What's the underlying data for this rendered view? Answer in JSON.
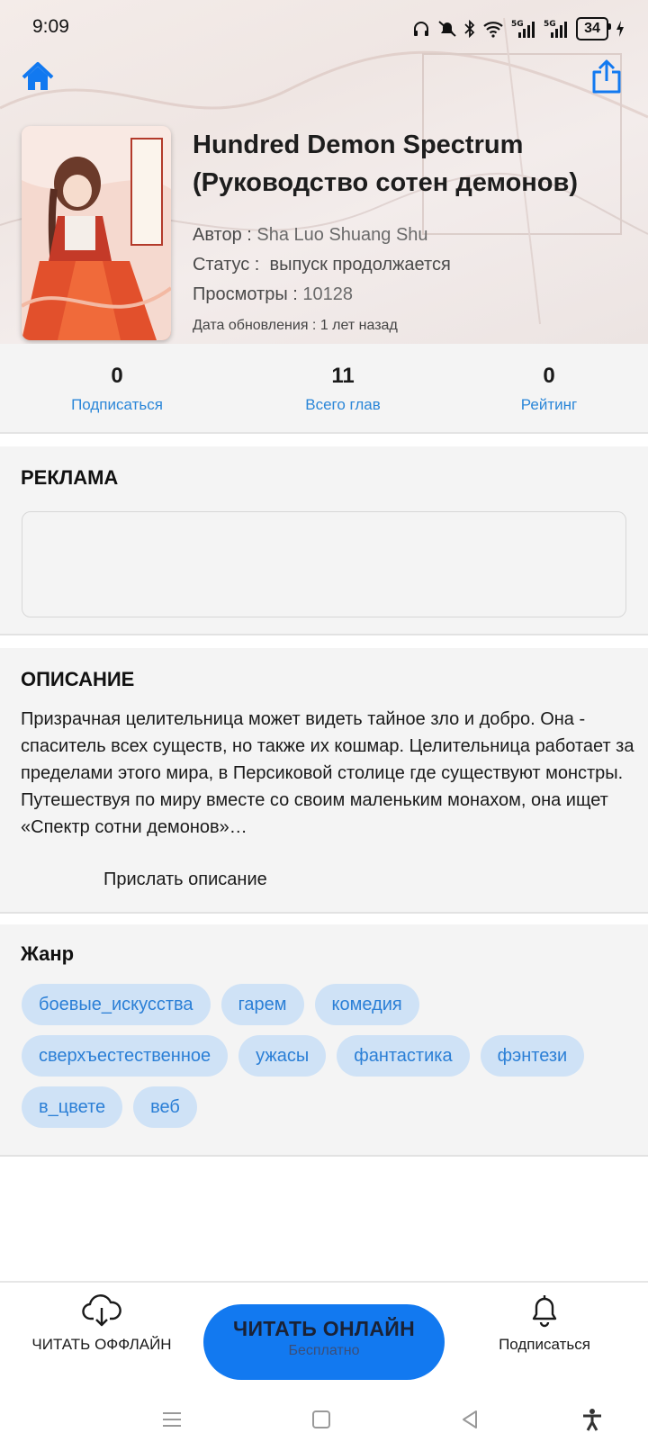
{
  "status_bar": {
    "time": "9:09",
    "battery": "34"
  },
  "book": {
    "title": "Hundred Demon Spectrum (Руководство сотен демонов)",
    "author_label": "Автор :",
    "author": "Sha Luo Shuang Shu",
    "status_label": "Статус :",
    "status": "выпуск продолжается",
    "views_label": "Просмотры :",
    "views": "10128",
    "updated_label": "Дата обновления :",
    "updated": "1 лет назад"
  },
  "stats": [
    {
      "value": "0",
      "label": "Подписаться"
    },
    {
      "value": "11",
      "label": "Всего глав"
    },
    {
      "value": "0",
      "label": "Рейтинг"
    }
  ],
  "ad": {
    "title": "РЕКЛАМА"
  },
  "description": {
    "title": "ОПИСАНИЕ",
    "text": "Призрачная целительница может видеть тайное зло и добро. Она - спаситель всех существ, но также их кошмар. Целительница работает за пределами этого мира, в Персиковой столице где существуют монстры. Путешествуя по миру вместе со своим маленьким монахом, она ищет «Спектр сотни демонов»…",
    "submit_label": "Прислать описание"
  },
  "genres": {
    "title": "Жанр",
    "items": [
      "боевые_искусства",
      "гарем",
      "комедия",
      "сверхъестественное",
      "ужасы",
      "фантастика",
      "фэнтези",
      "в_цвете",
      "веб"
    ]
  },
  "bottom_bar": {
    "offline_label": "ЧИТАТЬ ОФФЛАЙН",
    "read_label": "ЧИТАТЬ ОНЛАЙН",
    "read_sub": "Бесплатно",
    "subscribe_label": "Подписаться"
  },
  "colors": {
    "accent": "#1279f0",
    "link": "#2a86d8",
    "chip_bg": "#cfe2f6"
  },
  "icons": [
    "home-icon",
    "share-icon",
    "cloud-download-icon",
    "bell-icon",
    "menu-icon",
    "home-square-icon",
    "back-icon",
    "accessibility-icon"
  ]
}
